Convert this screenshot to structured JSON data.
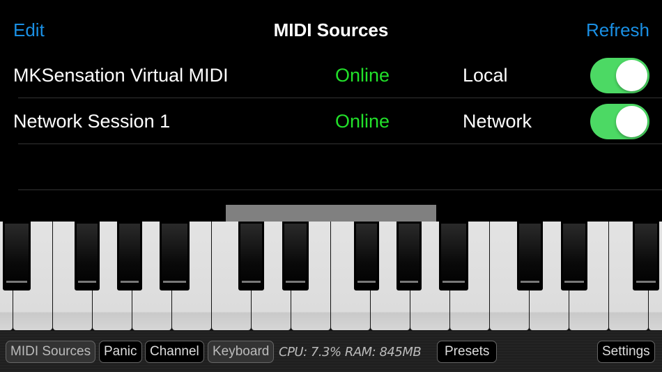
{
  "header": {
    "edit_label": "Edit",
    "title": "MIDI Sources",
    "refresh_label": "Refresh"
  },
  "sources": [
    {
      "name": "MKSensation Virtual MIDI",
      "status": "Online",
      "type": "Local",
      "enabled": true
    },
    {
      "name": "Network Session 1",
      "status": "Online",
      "type": "Network",
      "enabled": true
    }
  ],
  "toolbar": {
    "midi_sources": "MIDI Sources",
    "panic": "Panic",
    "channel": "Channel",
    "keyboard": "Keyboard",
    "stats": "CPU: 7.3%   RAM: 845MB",
    "presets": "Presets",
    "settings": "Settings"
  },
  "colors": {
    "accent": "#1a8fe3",
    "online": "#22e02a",
    "toggle_on": "#4cd964"
  }
}
